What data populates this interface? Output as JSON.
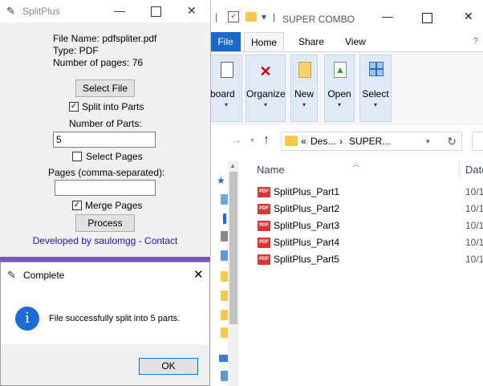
{
  "splitplus": {
    "title": "SplitPlus",
    "file_name": "File Name: pdfspliter.pdf",
    "type": "Type: PDF",
    "pages": "Number of pages: 76",
    "select_file": "Select File",
    "split_into_parts": "Split into Parts",
    "split_checked": "✓",
    "number_of_parts_label": "Number of Parts:",
    "number_of_parts_value": "5",
    "select_pages": "Select Pages",
    "pages_label": "Pages (comma-separated):",
    "pages_value": "",
    "merge_pages": "Merge Pages",
    "merge_checked": "✓",
    "process": "Process",
    "credit": "Developed by saulomgg - Contact"
  },
  "dialog": {
    "title": "Complete",
    "message": "File successfully split into 5 parts.",
    "ok": "OK",
    "icon_glyph": "i"
  },
  "explorer": {
    "title": "SUPER COMBO",
    "tabs": {
      "file": "File",
      "home": "Home",
      "share": "Share",
      "view": "View"
    },
    "ribbon": [
      {
        "label": "pboard",
        "icon": "clipboard-icon"
      },
      {
        "label": "Organize",
        "icon": "delete-icon"
      },
      {
        "label": "New",
        "icon": "new-folder-icon"
      },
      {
        "label": "Open",
        "icon": "open-icon"
      },
      {
        "label": "Select",
        "icon": "select-icon"
      }
    ],
    "address": {
      "prefix": "«",
      "crumb1": "Des...",
      "sep": "›",
      "crumb2": "SUPER..."
    },
    "columns": {
      "name": "Name",
      "date": "Date"
    },
    "files": [
      {
        "name": "SplitPlus_Part1",
        "date": "10/1"
      },
      {
        "name": "SplitPlus_Part2",
        "date": "10/1"
      },
      {
        "name": "SplitPlus_Part3",
        "date": "10/1"
      },
      {
        "name": "SplitPlus_Part4",
        "date": "10/1"
      },
      {
        "name": "SplitPlus_Part5",
        "date": "10/1"
      }
    ]
  }
}
